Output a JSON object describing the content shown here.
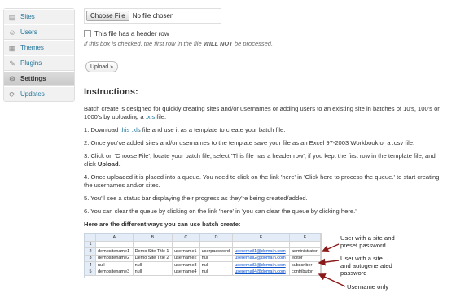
{
  "sidebar": {
    "items": [
      {
        "label": "Sites",
        "icon": "sites-icon",
        "active": false
      },
      {
        "label": "Users",
        "icon": "users-icon",
        "active": false
      },
      {
        "label": "Themes",
        "icon": "themes-icon",
        "active": false
      },
      {
        "label": "Plugins",
        "icon": "plugins-icon",
        "active": false
      },
      {
        "label": "Settings",
        "icon": "settings-icon",
        "active": true
      },
      {
        "label": "Updates",
        "icon": "updates-icon",
        "active": false
      }
    ]
  },
  "form": {
    "choose_file_label": "Choose File",
    "no_file_text": "No file chosen",
    "header_checkbox_label": "This file has a header row",
    "hint_prefix": "If this box is checked, the first row in the file ",
    "hint_bold": "WILL NOT",
    "hint_suffix": " be processed.",
    "upload_label": "Upload »"
  },
  "instructions": {
    "heading": "Instructions:",
    "intro_a": "Batch create is designed for quickly creating sites and/or usernames or adding users to an existing site in batches of 10's, 100's or 1000's by uploading a ",
    "intro_link": ".xls",
    "intro_b": " file.",
    "step1_a": "1. Download ",
    "step1_link": "this .xls",
    "step1_b": " file and use it as a template to create your batch file.",
    "step2": "2. Once you've added sites and/or usernames to the template save your file as an Excel 97-2003 Workbook or a .csv file.",
    "step3_a": "3. Click on 'Choose File', locate your batch file, select 'This file has a header row', if you kept the first row in the template file, and click ",
    "step3_bold": "Upload",
    "step3_b": ".",
    "step4": "4. Once uploaded it is placed into a queue. You need to click on the link 'here' in 'Click here to process the queue.' to start creating the usernames and/or sites.",
    "step5": "5. You'll see a status bar displaying their progress as they're being created/added.",
    "step6": "6. You can clear the queue by clicking on the link 'here' in 'you can clear the queue by clicking here.'",
    "ways_heading": "Here are the different ways you can use batch create:"
  },
  "spreadsheet": {
    "columns": [
      "A",
      "B",
      "C",
      "D",
      "E",
      "F"
    ],
    "rows": [
      {
        "n": "1",
        "cells": [
          "",
          "",
          "",
          "",
          "",
          ""
        ]
      },
      {
        "n": "2",
        "cells": [
          "demositename1",
          "Demo Site Title 1",
          "username1",
          "userpassword",
          "useremail1@domain.com",
          "administrator"
        ]
      },
      {
        "n": "3",
        "cells": [
          "demositename2",
          "Demo Site Title 2",
          "username2",
          "null",
          "useremail2@domain.com",
          "editor"
        ]
      },
      {
        "n": "4",
        "cells": [
          "null",
          "null",
          "username3",
          "null",
          "useremail3@domain.com",
          "subscriber"
        ]
      },
      {
        "n": "5",
        "cells": [
          "demositename3",
          "null",
          "username4",
          "null",
          "useremail4@domain.com",
          "contributor"
        ]
      }
    ]
  },
  "callouts": {
    "a1": "User with a site and",
    "a2": "preset password",
    "b1": "User with a site",
    "b2": "and autogenerated",
    "b3": "password",
    "c1": "Username only"
  },
  "colors": {
    "link": "#21759b",
    "arrow": "#8b1a1a",
    "sidebar_bg": "#f1f1f1"
  }
}
